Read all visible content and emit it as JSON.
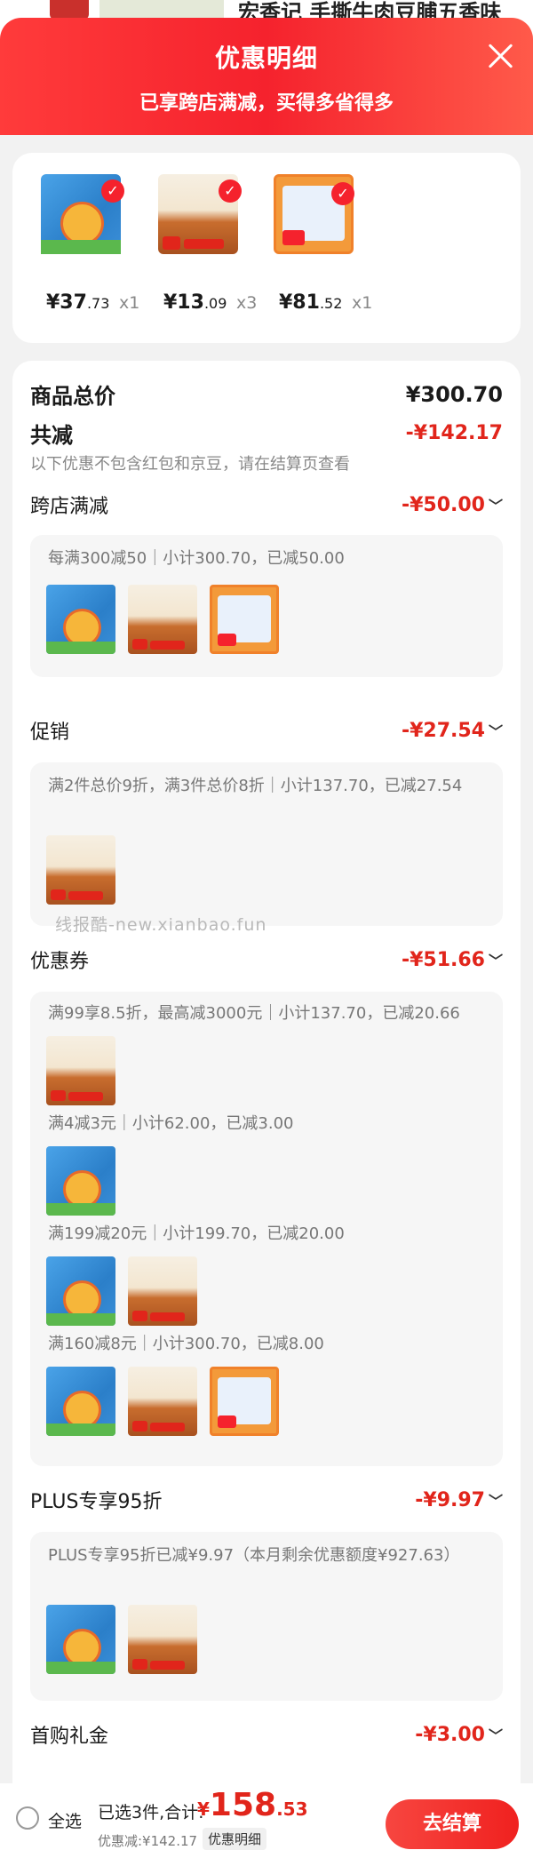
{
  "background_page": {
    "product_title": "宏香记 手撕牛肉豆脯五香味"
  },
  "header": {
    "title": "优惠明细",
    "subtitle": "已享跨店满减，买得多省得多"
  },
  "products": [
    {
      "image": "img-a",
      "price_int": "¥37",
      "price_dec": ".73",
      "qty": "x1"
    },
    {
      "image": "img-b",
      "price_int": "¥13",
      "price_dec": ".09",
      "qty": "x3"
    },
    {
      "image": "img-c",
      "price_int": "¥81",
      "price_dec": ".52",
      "qty": "x1"
    }
  ],
  "summary": {
    "total_label": "商品总价",
    "total_value": "¥300.70",
    "reduce_label": "共减",
    "reduce_value": "-¥142.17",
    "reduce_note": "以下优惠不包含红包和京豆，请在结算页查看"
  },
  "sections": {
    "cross_store": {
      "label": "跨店满减",
      "value": "-¥50.00",
      "desc": "每满300减50｜小计300.70，已减50.00"
    },
    "promo": {
      "label": "促销",
      "value": "-¥27.54",
      "desc": "满2件总价9折，满3件总价8折｜小计137.70，已减27.54"
    },
    "coupon": {
      "label": "优惠券",
      "value": "-¥51.66",
      "items": [
        "满99享8.5折，最高减3000元｜小计137.70，已减20.66",
        "满4减3元｜小计62.00，已减3.00",
        "满199减20元｜小计199.70，已减20.00",
        "满160减8元｜小计300.70，已减8.00"
      ]
    },
    "plus": {
      "label": "PLUS专享95折",
      "value": "-¥9.97",
      "desc": "PLUS专享95折已减¥9.97（本月剩余优惠额度¥927.63）"
    },
    "first_gift": {
      "label": "首购礼金",
      "value": "-¥3.00"
    }
  },
  "watermark": "线报酷-new.xianbao.fun",
  "bottom_bar": {
    "select_all": "全选",
    "selected_info": "已选3件,合计:",
    "total_yen": "¥",
    "total_int": "158",
    "total_dec": ".53",
    "saved": "优惠减:¥142.17",
    "detail_tag": "优惠明细",
    "checkout": "去结算"
  },
  "colors": {
    "accent": "#f5222d",
    "discount": "#e1251b"
  }
}
